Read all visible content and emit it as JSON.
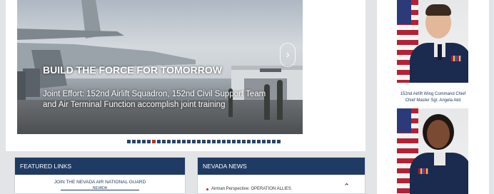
{
  "hero": {
    "title": "BUILD THE FORCE FOR TOMORROW",
    "caption": "Joint Effort: 152nd Airlift Squadron, 152nd Civil Support Team and Air Terminal Function accomplish joint training",
    "next_icon": "chevron-right-icon",
    "slide_count": 31,
    "active_slide": 5
  },
  "featured_links": {
    "header": "FEATURED LINKS",
    "link": "JOIN THE NEVADA AIR NATIONAL GUARD",
    "sub_link": "NEVADA"
  },
  "news": {
    "header": "NEVADA NEWS",
    "items": [
      "Airman Perspective: OPERATION ALLIES"
    ],
    "scroll_icon": "chevron-up-icon"
  },
  "sidebar": {
    "caption_lines": [
      "152nd Airlift Wing Command Chief",
      "Chief Master Sgt. Angela Akit"
    ]
  },
  "colors": {
    "navy": "#1f3b63",
    "accent_red": "#b7302a",
    "page_bg": "#e3e4e6"
  }
}
